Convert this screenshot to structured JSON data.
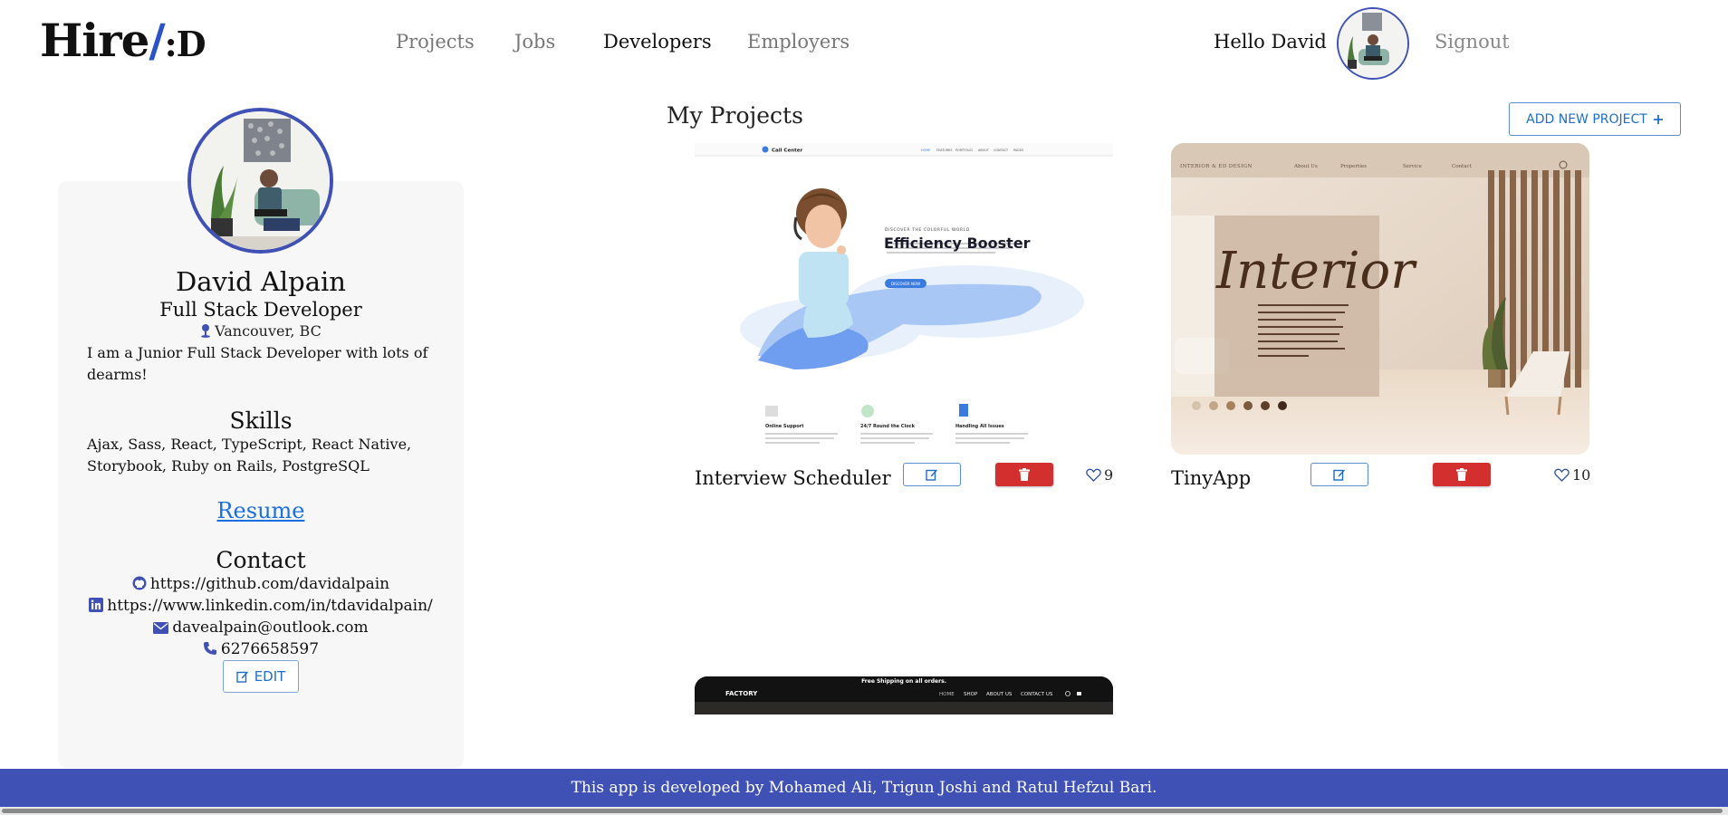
{
  "header": {
    "logo_main": "Hire",
    "logo_slash": "/",
    "logo_tail": ":D",
    "nav": [
      "Projects",
      "Jobs",
      "Developers",
      "Employers"
    ],
    "active_nav": "Developers",
    "greeting": "Hello David",
    "signout": "Signout"
  },
  "profile": {
    "name": "David Alpain",
    "title": "Full Stack Developer",
    "location": "Vancouver, BC",
    "bio": "I am a Junior Full Stack Developer with lots of dearms!",
    "skills_heading": "Skills",
    "skills": "Ajax, Sass, React, TypeScript, React Native, Storybook, Ruby on Rails, PostgreSQL",
    "resume_label": "Resume",
    "contact_heading": "Contact",
    "github": "https://github.com/davidalpain",
    "linkedin": "https://www.linkedin.com/in/tdavidalpain/",
    "email": "davealpain@outlook.com",
    "phone": "6276658597",
    "edit_label": "EDIT"
  },
  "projects": {
    "heading": "My Projects",
    "add_label": "ADD NEW PROJECT",
    "items": [
      {
        "name": "Interview Scheduler",
        "likes": "9",
        "thumb": {
          "brand": "Call Center",
          "nav": [
            "HOME",
            "FEATURES",
            "PORTFOLIO",
            "ABOUT",
            "CONTACT",
            "PAGES"
          ],
          "kicker": "DISCOVER THE COLORFUL WORLD",
          "headline": "Efficiency Booster",
          "cta": "DISCOVER NOW",
          "features": [
            "Online Support",
            "24/7 Round the Clock",
            "Handling All Issues"
          ]
        }
      },
      {
        "name": "TinyApp",
        "likes": "10",
        "thumb": {
          "brand": "INTERIOR & ED DESIGN",
          "nav": [
            "About Us",
            "Properties",
            "Service",
            "Contact"
          ],
          "headline": "Interior",
          "body": "Lorem ipsum dolor sit amet, consectetur adipiscing elit. Proin suscipit elit ex, nec ullamcorper nunc eleifend vel. Integer vel lorem viverra est posuere pulvinar sed in lacus."
        }
      },
      {
        "name": "",
        "likes": "",
        "thumb": {
          "topbar": "Free Shipping on all orders.",
          "brand": "FACTORY",
          "nav": [
            "HOME",
            "SHOP",
            "ABOUT US",
            "CONTACT US"
          ]
        }
      }
    ]
  },
  "footer": {
    "text": "This app is developed by Mohamed Ali, Trigun Joshi and Ratul Hefzul Bari."
  },
  "colors": {
    "primary": "#3f51b5",
    "link": "#1a6fe0",
    "danger": "#d32f2f",
    "button_outline": "#5b8fd1"
  },
  "icons": [
    "location-pin-icon",
    "github-icon",
    "linkedin-icon",
    "mail-icon",
    "phone-icon",
    "edit-icon",
    "trash-icon",
    "heart-icon",
    "plus-icon"
  ]
}
